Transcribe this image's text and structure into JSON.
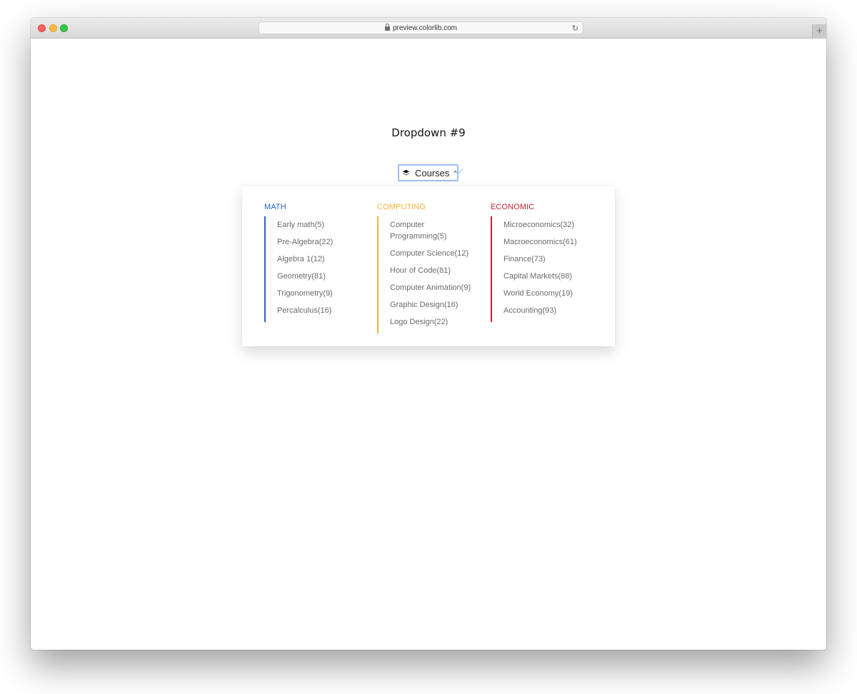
{
  "browser": {
    "url": "preview.colorlib.com",
    "new_tab": "+"
  },
  "page": {
    "title": "Dropdown #9"
  },
  "dropdown": {
    "label": "Courses",
    "icon": "layers-icon",
    "chevron": "^"
  },
  "menu": {
    "columns": [
      {
        "heading": "MATH",
        "color": "#2662cf",
        "items": [
          "Early math(5)",
          "Pre-Algebra(22)",
          "Algebra 1(12)",
          "Geometry(81)",
          "Trigonometry(9)",
          "Percalculus(16)"
        ]
      },
      {
        "heading": "COMPUTING",
        "color": "#f6b233",
        "items": [
          "Computer Programming(5)",
          "Computer Science(12)",
          "Hour of Code(81)",
          "Computer Animation(9)",
          "Graphic Design(16)",
          "Logo Design(22)"
        ]
      },
      {
        "heading": "ECONOMIC",
        "color": "#c8202f",
        "items": [
          "Microeconomics(32)",
          "Macroeconomics(61)",
          "Finance(73)",
          "Capital Markets(88)",
          "World Economy(19)",
          "Accounting(93)"
        ]
      }
    ]
  }
}
